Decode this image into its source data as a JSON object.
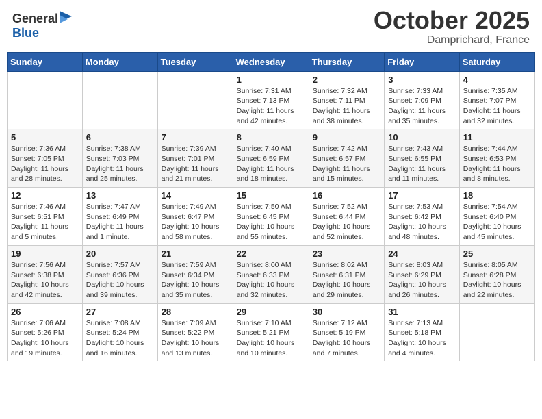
{
  "header": {
    "logo_line1": "General",
    "logo_line2": "Blue",
    "month": "October 2025",
    "location": "Damprichard, France"
  },
  "days_of_week": [
    "Sunday",
    "Monday",
    "Tuesday",
    "Wednesday",
    "Thursday",
    "Friday",
    "Saturday"
  ],
  "weeks": [
    [
      {
        "num": "",
        "info": ""
      },
      {
        "num": "",
        "info": ""
      },
      {
        "num": "",
        "info": ""
      },
      {
        "num": "1",
        "info": "Sunrise: 7:31 AM\nSunset: 7:13 PM\nDaylight: 11 hours\nand 42 minutes."
      },
      {
        "num": "2",
        "info": "Sunrise: 7:32 AM\nSunset: 7:11 PM\nDaylight: 11 hours\nand 38 minutes."
      },
      {
        "num": "3",
        "info": "Sunrise: 7:33 AM\nSunset: 7:09 PM\nDaylight: 11 hours\nand 35 minutes."
      },
      {
        "num": "4",
        "info": "Sunrise: 7:35 AM\nSunset: 7:07 PM\nDaylight: 11 hours\nand 32 minutes."
      }
    ],
    [
      {
        "num": "5",
        "info": "Sunrise: 7:36 AM\nSunset: 7:05 PM\nDaylight: 11 hours\nand 28 minutes."
      },
      {
        "num": "6",
        "info": "Sunrise: 7:38 AM\nSunset: 7:03 PM\nDaylight: 11 hours\nand 25 minutes."
      },
      {
        "num": "7",
        "info": "Sunrise: 7:39 AM\nSunset: 7:01 PM\nDaylight: 11 hours\nand 21 minutes."
      },
      {
        "num": "8",
        "info": "Sunrise: 7:40 AM\nSunset: 6:59 PM\nDaylight: 11 hours\nand 18 minutes."
      },
      {
        "num": "9",
        "info": "Sunrise: 7:42 AM\nSunset: 6:57 PM\nDaylight: 11 hours\nand 15 minutes."
      },
      {
        "num": "10",
        "info": "Sunrise: 7:43 AM\nSunset: 6:55 PM\nDaylight: 11 hours\nand 11 minutes."
      },
      {
        "num": "11",
        "info": "Sunrise: 7:44 AM\nSunset: 6:53 PM\nDaylight: 11 hours\nand 8 minutes."
      }
    ],
    [
      {
        "num": "12",
        "info": "Sunrise: 7:46 AM\nSunset: 6:51 PM\nDaylight: 11 hours\nand 5 minutes."
      },
      {
        "num": "13",
        "info": "Sunrise: 7:47 AM\nSunset: 6:49 PM\nDaylight: 11 hours\nand 1 minute."
      },
      {
        "num": "14",
        "info": "Sunrise: 7:49 AM\nSunset: 6:47 PM\nDaylight: 10 hours\nand 58 minutes."
      },
      {
        "num": "15",
        "info": "Sunrise: 7:50 AM\nSunset: 6:45 PM\nDaylight: 10 hours\nand 55 minutes."
      },
      {
        "num": "16",
        "info": "Sunrise: 7:52 AM\nSunset: 6:44 PM\nDaylight: 10 hours\nand 52 minutes."
      },
      {
        "num": "17",
        "info": "Sunrise: 7:53 AM\nSunset: 6:42 PM\nDaylight: 10 hours\nand 48 minutes."
      },
      {
        "num": "18",
        "info": "Sunrise: 7:54 AM\nSunset: 6:40 PM\nDaylight: 10 hours\nand 45 minutes."
      }
    ],
    [
      {
        "num": "19",
        "info": "Sunrise: 7:56 AM\nSunset: 6:38 PM\nDaylight: 10 hours\nand 42 minutes."
      },
      {
        "num": "20",
        "info": "Sunrise: 7:57 AM\nSunset: 6:36 PM\nDaylight: 10 hours\nand 39 minutes."
      },
      {
        "num": "21",
        "info": "Sunrise: 7:59 AM\nSunset: 6:34 PM\nDaylight: 10 hours\nand 35 minutes."
      },
      {
        "num": "22",
        "info": "Sunrise: 8:00 AM\nSunset: 6:33 PM\nDaylight: 10 hours\nand 32 minutes."
      },
      {
        "num": "23",
        "info": "Sunrise: 8:02 AM\nSunset: 6:31 PM\nDaylight: 10 hours\nand 29 minutes."
      },
      {
        "num": "24",
        "info": "Sunrise: 8:03 AM\nSunset: 6:29 PM\nDaylight: 10 hours\nand 26 minutes."
      },
      {
        "num": "25",
        "info": "Sunrise: 8:05 AM\nSunset: 6:28 PM\nDaylight: 10 hours\nand 22 minutes."
      }
    ],
    [
      {
        "num": "26",
        "info": "Sunrise: 7:06 AM\nSunset: 5:26 PM\nDaylight: 10 hours\nand 19 minutes."
      },
      {
        "num": "27",
        "info": "Sunrise: 7:08 AM\nSunset: 5:24 PM\nDaylight: 10 hours\nand 16 minutes."
      },
      {
        "num": "28",
        "info": "Sunrise: 7:09 AM\nSunset: 5:22 PM\nDaylight: 10 hours\nand 13 minutes."
      },
      {
        "num": "29",
        "info": "Sunrise: 7:10 AM\nSunset: 5:21 PM\nDaylight: 10 hours\nand 10 minutes."
      },
      {
        "num": "30",
        "info": "Sunrise: 7:12 AM\nSunset: 5:19 PM\nDaylight: 10 hours\nand 7 minutes."
      },
      {
        "num": "31",
        "info": "Sunrise: 7:13 AM\nSunset: 5:18 PM\nDaylight: 10 hours\nand 4 minutes."
      },
      {
        "num": "",
        "info": ""
      }
    ]
  ]
}
